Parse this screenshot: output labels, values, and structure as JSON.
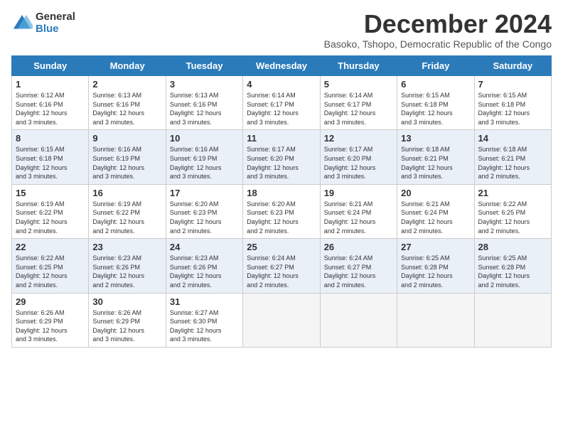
{
  "logo": {
    "general": "General",
    "blue": "Blue"
  },
  "title": "December 2024",
  "subtitle": "Basoko, Tshopo, Democratic Republic of the Congo",
  "days_of_week": [
    "Sunday",
    "Monday",
    "Tuesday",
    "Wednesday",
    "Thursday",
    "Friday",
    "Saturday"
  ],
  "weeks": [
    [
      {
        "day": "1",
        "rise": "6:12 AM",
        "set": "6:16 PM",
        "daylight": "12 hours and 3 minutes."
      },
      {
        "day": "2",
        "rise": "6:13 AM",
        "set": "6:16 PM",
        "daylight": "12 hours and 3 minutes."
      },
      {
        "day": "3",
        "rise": "6:13 AM",
        "set": "6:16 PM",
        "daylight": "12 hours and 3 minutes."
      },
      {
        "day": "4",
        "rise": "6:14 AM",
        "set": "6:17 PM",
        "daylight": "12 hours and 3 minutes."
      },
      {
        "day": "5",
        "rise": "6:14 AM",
        "set": "6:17 PM",
        "daylight": "12 hours and 3 minutes."
      },
      {
        "day": "6",
        "rise": "6:15 AM",
        "set": "6:18 PM",
        "daylight": "12 hours and 3 minutes."
      },
      {
        "day": "7",
        "rise": "6:15 AM",
        "set": "6:18 PM",
        "daylight": "12 hours and 3 minutes."
      }
    ],
    [
      {
        "day": "8",
        "rise": "6:15 AM",
        "set": "6:18 PM",
        "daylight": "12 hours and 3 minutes."
      },
      {
        "day": "9",
        "rise": "6:16 AM",
        "set": "6:19 PM",
        "daylight": "12 hours and 3 minutes."
      },
      {
        "day": "10",
        "rise": "6:16 AM",
        "set": "6:19 PM",
        "daylight": "12 hours and 3 minutes."
      },
      {
        "day": "11",
        "rise": "6:17 AM",
        "set": "6:20 PM",
        "daylight": "12 hours and 3 minutes."
      },
      {
        "day": "12",
        "rise": "6:17 AM",
        "set": "6:20 PM",
        "daylight": "12 hours and 3 minutes."
      },
      {
        "day": "13",
        "rise": "6:18 AM",
        "set": "6:21 PM",
        "daylight": "12 hours and 3 minutes."
      },
      {
        "day": "14",
        "rise": "6:18 AM",
        "set": "6:21 PM",
        "daylight": "12 hours and 2 minutes."
      }
    ],
    [
      {
        "day": "15",
        "rise": "6:19 AM",
        "set": "6:22 PM",
        "daylight": "12 hours and 2 minutes."
      },
      {
        "day": "16",
        "rise": "6:19 AM",
        "set": "6:22 PM",
        "daylight": "12 hours and 2 minutes."
      },
      {
        "day": "17",
        "rise": "6:20 AM",
        "set": "6:23 PM",
        "daylight": "12 hours and 2 minutes."
      },
      {
        "day": "18",
        "rise": "6:20 AM",
        "set": "6:23 PM",
        "daylight": "12 hours and 2 minutes."
      },
      {
        "day": "19",
        "rise": "6:21 AM",
        "set": "6:24 PM",
        "daylight": "12 hours and 2 minutes."
      },
      {
        "day": "20",
        "rise": "6:21 AM",
        "set": "6:24 PM",
        "daylight": "12 hours and 2 minutes."
      },
      {
        "day": "21",
        "rise": "6:22 AM",
        "set": "6:25 PM",
        "daylight": "12 hours and 2 minutes."
      }
    ],
    [
      {
        "day": "22",
        "rise": "6:22 AM",
        "set": "6:25 PM",
        "daylight": "12 hours and 2 minutes."
      },
      {
        "day": "23",
        "rise": "6:23 AM",
        "set": "6:26 PM",
        "daylight": "12 hours and 2 minutes."
      },
      {
        "day": "24",
        "rise": "6:23 AM",
        "set": "6:26 PM",
        "daylight": "12 hours and 2 minutes."
      },
      {
        "day": "25",
        "rise": "6:24 AM",
        "set": "6:27 PM",
        "daylight": "12 hours and 2 minutes."
      },
      {
        "day": "26",
        "rise": "6:24 AM",
        "set": "6:27 PM",
        "daylight": "12 hours and 2 minutes."
      },
      {
        "day": "27",
        "rise": "6:25 AM",
        "set": "6:28 PM",
        "daylight": "12 hours and 2 minutes."
      },
      {
        "day": "28",
        "rise": "6:25 AM",
        "set": "6:28 PM",
        "daylight": "12 hours and 2 minutes."
      }
    ],
    [
      {
        "day": "29",
        "rise": "6:26 AM",
        "set": "6:29 PM",
        "daylight": "12 hours and 3 minutes."
      },
      {
        "day": "30",
        "rise": "6:26 AM",
        "set": "6:29 PM",
        "daylight": "12 hours and 3 minutes."
      },
      {
        "day": "31",
        "rise": "6:27 AM",
        "set": "6:30 PM",
        "daylight": "12 hours and 3 minutes."
      },
      null,
      null,
      null,
      null
    ]
  ],
  "labels": {
    "sunrise": "Sunrise:",
    "sunset": "Sunset:",
    "daylight": "Daylight:"
  }
}
